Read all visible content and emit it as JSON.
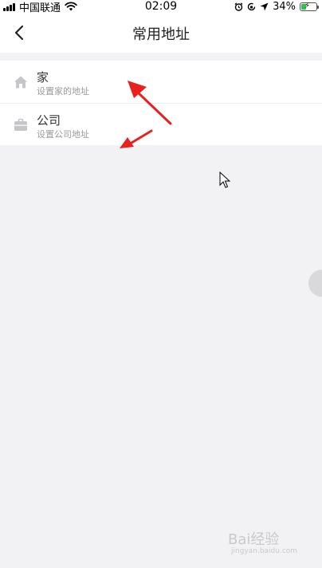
{
  "status_bar": {
    "carrier": "中国联通",
    "time": "02:09",
    "battery": "34%",
    "battery_level": 0.34,
    "battery_color": "#2fc14a"
  },
  "header": {
    "title": "常用地址",
    "back_icon": "chevron-left-icon"
  },
  "addresses": [
    {
      "title": "家",
      "subtitle": "设置家的地址",
      "icon": "home-icon"
    },
    {
      "title": "公司",
      "subtitle": "设置公司地址",
      "icon": "briefcase-icon"
    }
  ],
  "annotation_color": "#e8201e",
  "watermark": {
    "text": "Bai经验",
    "url": "jingyan.baidu.com"
  }
}
